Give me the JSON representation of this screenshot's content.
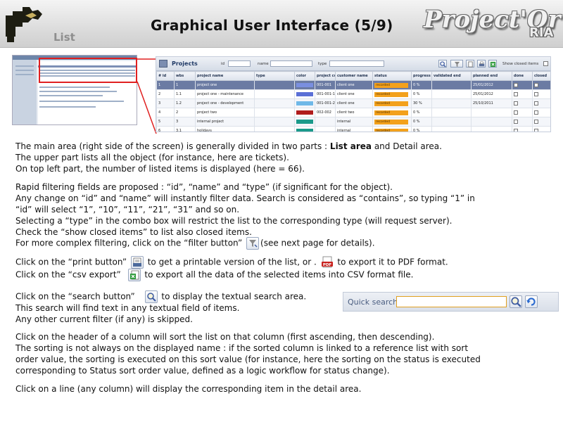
{
  "header": {
    "section": "List",
    "title": "Graphical User Interface (5/9)",
    "brand": "Project'Or",
    "brand_sub": "RIA"
  },
  "list_panel": {
    "title": "Projects",
    "filter_id_label": "id",
    "filter_name_label": "name",
    "filter_type_label": "type",
    "show_closed_label": "Show closed items",
    "columns": [
      "# id",
      "wbs",
      "project name",
      "type",
      "color",
      "project code",
      "customer name",
      "status",
      "progress",
      "validated end",
      "planned end",
      "done",
      "closed"
    ],
    "rows": [
      {
        "id": "1",
        "wbs": "1",
        "name": "project one",
        "type": "",
        "color": "#7a8fe0",
        "code": "001-001",
        "customer": "client one",
        "status": "recorded",
        "progress": "0 %",
        "validated_end": "",
        "planned_end": "25/01/2012"
      },
      {
        "id": "2",
        "wbs": "1.1",
        "name": "project one - maintenance",
        "type": "",
        "color": "#5a6fd6",
        "code": "001-001-1",
        "customer": "client one",
        "status": "recorded",
        "progress": "0 %",
        "validated_end": "",
        "planned_end": "25/01/2012"
      },
      {
        "id": "3",
        "wbs": "1.2",
        "name": "project one - development",
        "type": "",
        "color": "#6fb8e8",
        "code": "001-001-2",
        "customer": "client one",
        "status": "recorded",
        "progress": "30 %",
        "validated_end": "",
        "planned_end": "25/10/2011"
      },
      {
        "id": "4",
        "wbs": "2",
        "name": "project two",
        "type": "",
        "color": "#b01c1c",
        "code": "002-002",
        "customer": "client two",
        "status": "recorded",
        "progress": "0 %",
        "validated_end": "",
        "planned_end": ""
      },
      {
        "id": "5",
        "wbs": "3",
        "name": "internal project",
        "type": "",
        "color": "#1a9a8a",
        "code": "",
        "customer": "internal",
        "status": "recorded",
        "progress": "0 %",
        "validated_end": "",
        "planned_end": ""
      },
      {
        "id": "6",
        "wbs": "3.1",
        "name": "holidays",
        "type": "",
        "color": "#1a9a8a",
        "code": "",
        "customer": "internal",
        "status": "recorded",
        "progress": "0 %",
        "validated_end": "",
        "planned_end": ""
      }
    ]
  },
  "paragraphs": {
    "p1_l1a": "The main area (right side of the screen) is generally divided in two parts : ",
    "p1_l1b": "List area",
    "p1_l1c": " and Detail area.",
    "p1_l2": "The upper part lists all the object (for instance, here are tickets).",
    "p1_l3": "On top left part, the number of listed items is displayed (here = 66).",
    "p2_l1": "Rapid filtering fields are proposed : “id”, “name” and “type” (if significant for the object).",
    "p2_l2": "Any change on “id” and “name” will instantly filter data. Search is considered as “contains”, so typing “1” in",
    "p2_l3": "“id” will select “1”, “10”, “11”, “21”, “31” and so on.",
    "p2_l4": "Selecting a “type” in the combo box will restrict the list to the corresponding type (will request server).",
    "p2_l5": "Check the “show closed items” to list also closed items.",
    "p2_l6a": "For more complex filtering, click on the “filter button”",
    "p2_l6b": "(see next page for details).",
    "p3_l1a": "Click on the “print button”",
    "p3_l1b": "to get a printable version of the list, or  .",
    "p3_l1c": "to export it to PDF format.",
    "p3_l2a": "Click on the “csv export”",
    "p3_l2b": "to export all the data of the selected items into CSV format file.",
    "p4_l1a": "Click on the “search button”",
    "p4_l1b": "to display the textual search area.",
    "p4_l2": "This search will find text in any textual field of items.",
    "p4_l3": "Any other current filter (if any) is skipped.",
    "p5_l1": "Click on the header of a column will sort the list on that column (first ascending, then descending).",
    "p5_l2": "The sorting is not always on the displayed name : if the sorted column is linked to a reference list with sort",
    "p5_l3": "order value, the sorting is executed on this sort value (for instance, here the sorting on the status is executed",
    "p5_l4": "corresponding to Status sort order value, defined as a logic workflow for status change).",
    "p6_l1": "Click on a line (any column) will display the corresponding item in the detail area."
  },
  "quick_search": {
    "label": "Quick search",
    "value": ""
  },
  "colors": {
    "accent_red": "#e02020",
    "selected_row": "#6b7ba3",
    "status_recorded": "#f3a11c",
    "title_blue": "#203a66"
  },
  "icons": [
    "filter-icon",
    "print-icon",
    "pdf-icon",
    "csv-icon",
    "search-icon",
    "undo-icon",
    "new-icon"
  ]
}
